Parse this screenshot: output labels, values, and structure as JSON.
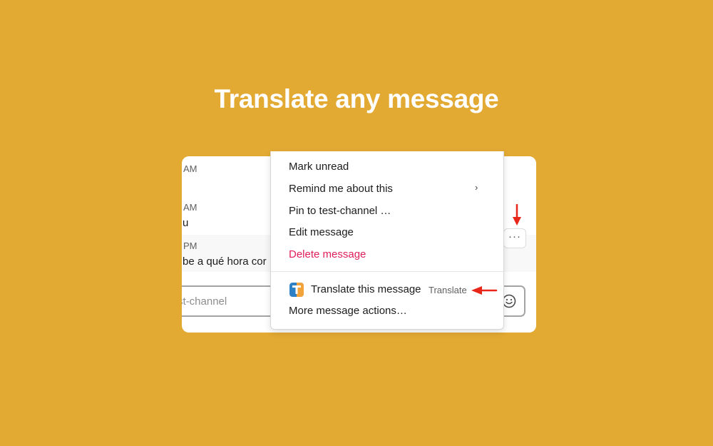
{
  "headline": "Translate any message",
  "messages": [
    {
      "time": "AM",
      "text": ""
    },
    {
      "time": "AM",
      "text": "u"
    },
    {
      "time": "PM",
      "text": "be a qué hora cor"
    }
  ],
  "composer": {
    "placeholder": "st-channel",
    "emoji_icon": "smiley-face-icon"
  },
  "more_actions_button": {
    "label": "···",
    "icon": "ellipsis-icon"
  },
  "context_menu": {
    "items": [
      {
        "label": "Mark unread"
      },
      {
        "label": "Remind me about this",
        "submenu": true
      },
      {
        "label": "Pin to test-channel …"
      },
      {
        "label": "Edit message"
      },
      {
        "label": "Delete message",
        "danger": true
      }
    ],
    "app_action": {
      "label": "Translate this message",
      "app_name": "Translate",
      "icon": "translate-app-icon"
    },
    "more_actions": "More message actions…"
  },
  "colors": {
    "background": "#E2A933",
    "danger": "#E01E5A",
    "arrow": "#E8271A",
    "icon_blue": "#2D7FC6",
    "icon_orange": "#F2A33A"
  }
}
